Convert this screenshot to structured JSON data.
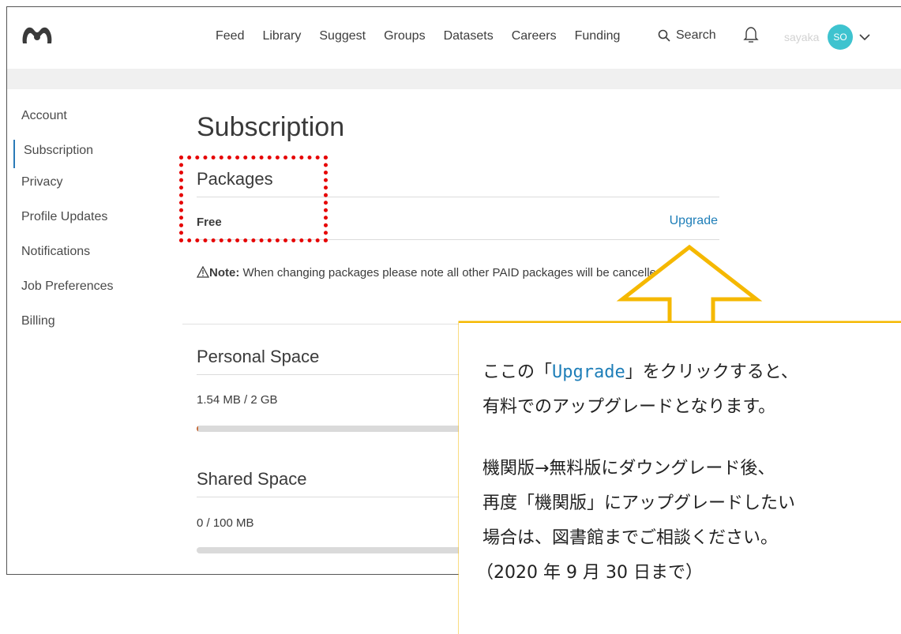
{
  "nav": {
    "links": [
      "Feed",
      "Library",
      "Suggest",
      "Groups",
      "Datasets",
      "Careers",
      "Funding"
    ],
    "search_label": "Search",
    "username": "sayaka",
    "avatar_initials": "SO"
  },
  "sidebar": {
    "items": [
      "Account",
      "Subscription",
      "Privacy",
      "Profile Updates",
      "Notifications",
      "Job Preferences",
      "Billing"
    ],
    "active_index": 1
  },
  "main": {
    "title": "Subscription",
    "packages": {
      "heading": "Packages",
      "current": "Free",
      "upgrade_label": "Upgrade",
      "note_label": "Note:",
      "note_text": "When changing packages please note all other PAID packages will be cancelled."
    },
    "personal_space": {
      "heading": "Personal Space",
      "usage": "1.54 MB / 2 GB",
      "fill_fraction": 0.0008
    },
    "shared_space": {
      "heading": "Shared Space",
      "usage": "0 / 100 MB",
      "fill_fraction": 0
    }
  },
  "callout": {
    "line1_pre": "ここの「",
    "line1_link": "Upgrade",
    "line1_post": "」をクリックすると、",
    "line2": "有料でのアップグレードとなります。",
    "line3": "機関版→無料版にダウングレード後、",
    "line4": "再度「機関版」にアップグレードしたい",
    "line5": "場合は、図書館までご相談ください。",
    "line6": "（2020 年 9 月 30 日まで）"
  },
  "colors": {
    "accent": "#1e7eb8",
    "avatar": "#3ec3cf",
    "callout_border": "#f5b800",
    "highlight_box": "#e60000"
  }
}
